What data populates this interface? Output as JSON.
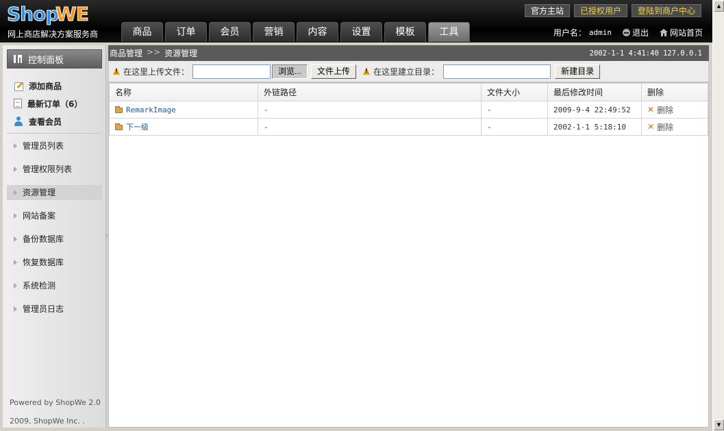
{
  "header": {
    "logo_shop": "Shop",
    "logo_we": "WE",
    "slogan": "网上商店解决方案服务商",
    "top_buttons": [
      "官方主站",
      "已授权用户",
      "登陆到商户中心"
    ],
    "nav_tabs": [
      "商品",
      "订单",
      "会员",
      "营销",
      "内容",
      "设置",
      "模板",
      "工具"
    ],
    "active_tab": "工具",
    "user_label": "用户名：",
    "user_name": "admin",
    "logout": "退出",
    "site_home": "网站首页"
  },
  "sidebar": {
    "panel_title": "控制面板",
    "quick": [
      "添加商品",
      "最新订单（6）",
      "查看会员"
    ],
    "menu": [
      "管理员列表",
      "管理权限列表",
      "资源管理",
      "网站备案",
      "备份数据库",
      "恢复数据库",
      "系统检测",
      "管理员日志"
    ],
    "active_menu": "资源管理",
    "footer_line1": "Powered by ShopWe 2.0",
    "footer_line2": "2009, ShopWe Inc. ."
  },
  "main": {
    "breadcrumb": [
      "商品管理",
      ">>",
      "资源管理"
    ],
    "stamp": "2002-1-1 4:41:40 127.0.0.1",
    "upload_label": "在这里上传文件：",
    "browse_button": "浏览...",
    "upload_button": "文件上传",
    "mkdir_label": "在这里建立目录：",
    "mkdir_button": "新建目录",
    "columns": [
      "名称",
      "外链路径",
      "文件大小",
      "最后修改时间",
      "删除"
    ],
    "rows": [
      {
        "name": "RemarkImage",
        "link": "-",
        "size": "-",
        "modified": "2009-9-4 22:49:52",
        "delete": "删除"
      },
      {
        "name": "下一级",
        "link": "-",
        "size": "-",
        "modified": "2002-1-1 5:18:10",
        "delete": "删除"
      }
    ]
  },
  "colors": {
    "header_bg": "#000000",
    "accent_blue": "#2f8fe0",
    "accent_orange": "#f5941f",
    "gold_text": "#f2d44a",
    "breadcrumb_bg": "#5a5a5a"
  }
}
